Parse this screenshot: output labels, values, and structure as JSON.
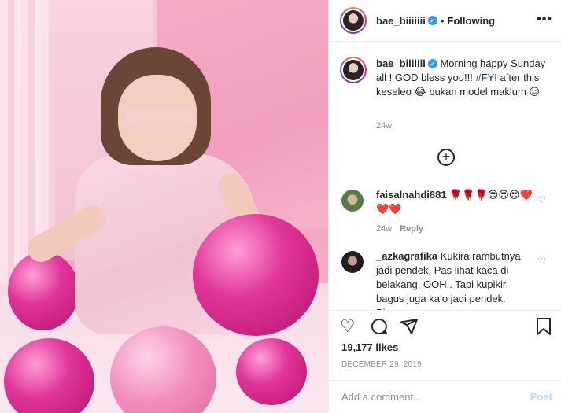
{
  "header": {
    "username": "bae_biiiiiii",
    "separator": "•",
    "follow_status": "Following",
    "more_icon": "more-icon"
  },
  "caption": {
    "username": "bae_biiiiiii",
    "text_before_tag": " Morning happy Sunday all ! GOD bless you!!! ",
    "hashtag": "#FYI",
    "text_after_tag": " after this keseleo 😂 bukan model maklum 😑",
    "time": "24w"
  },
  "comments": [
    {
      "username": "faisalnahdi881",
      "text": " 🌹🌹🌹😍😍😍❤️❤️❤️",
      "time": "24w",
      "reply_label": "Reply"
    },
    {
      "username": "_azkagrafika",
      "text": " Kukira rambutnya jadi pendek. Pas lihat kaca di belakang, OOH.. Tapi kupikir, bagus juga kalo jadi pendek. Biar..."
    }
  ],
  "stats": {
    "likes": "19,177 likes",
    "date": "DECEMBER 29, 2019"
  },
  "add_comment": {
    "placeholder": "Add a comment...",
    "post_label": "Post"
  },
  "icons": {
    "like": "heart-icon",
    "comment": "comment-icon",
    "share": "share-icon",
    "save": "bookmark-icon",
    "load_more": "plus-circle-icon"
  },
  "colors": {
    "link": "#003569",
    "verified": "#3897f0",
    "post_disabled": "#b2dffc",
    "muted": "#8e8e8e"
  }
}
